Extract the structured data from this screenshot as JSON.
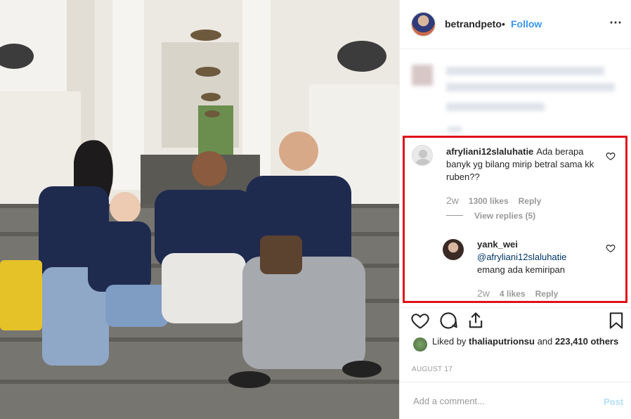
{
  "header": {
    "username": "betrandpeto",
    "separator": "•",
    "follow_label": "Follow",
    "more_icon": "⋯"
  },
  "comments": [
    {
      "username": "afryliani12slaluhatie",
      "text": "Ada berapa banyk yg bilang mirip betral sama kk ruben??",
      "time": "2w",
      "likes": "1300 likes",
      "reply_label": "Reply",
      "view_replies": "View replies (5)"
    },
    {
      "username": "yank_wei",
      "mention": "@afryliani12slaluhatie",
      "text": "emang ada kemiripan",
      "time": "2w",
      "likes": "4 likes",
      "reply_label": "Reply"
    }
  ],
  "engagement": {
    "liked_by_prefix": "Liked by",
    "liked_by_user": "thaliaputrionsu",
    "and_label": "and",
    "others": "223,410 others",
    "date": "AUGUST 17"
  },
  "add_comment": {
    "placeholder": "Add a comment...",
    "post_label": "Post"
  },
  "colors": {
    "accent": "#3897f0",
    "highlight_box": "#e0101a",
    "post_disabled": "#b2dffc"
  }
}
